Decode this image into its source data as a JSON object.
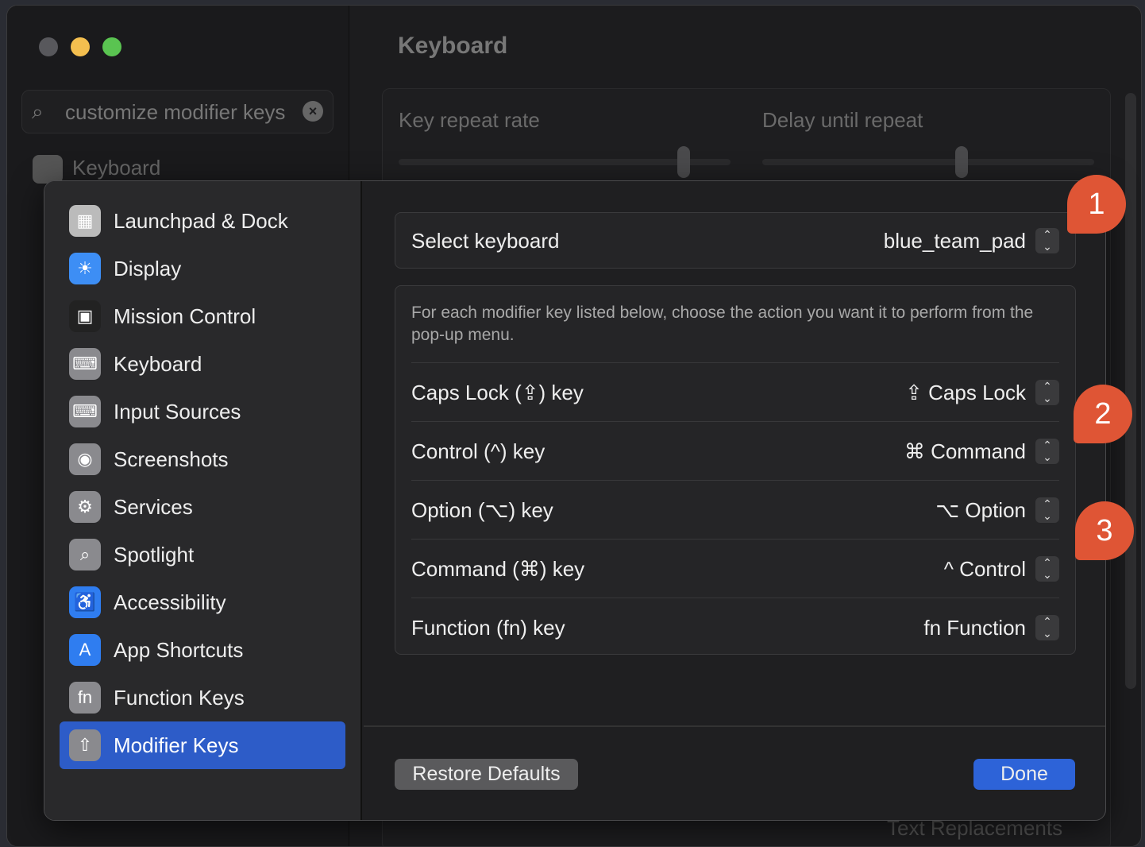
{
  "window": {
    "title": "Keyboard",
    "search": {
      "value": "customize modifier keys"
    },
    "bg_sidebar_item": "Keyboard",
    "key_repeat_label": "Key repeat rate",
    "delay_label": "Delay until repeat",
    "key_repeat_level": 0.86,
    "delay_level": 0.6,
    "bg_bottom_text": "Text Replacements"
  },
  "sheet": {
    "sidebar": [
      {
        "label": "Launchpad & Dock",
        "icon": "launchpad-icon"
      },
      {
        "label": "Display",
        "icon": "display-icon"
      },
      {
        "label": "Mission Control",
        "icon": "mission-control-icon"
      },
      {
        "label": "Keyboard",
        "icon": "keyboard-icon"
      },
      {
        "label": "Input Sources",
        "icon": "input-sources-icon"
      },
      {
        "label": "Screenshots",
        "icon": "screenshots-icon"
      },
      {
        "label": "Services",
        "icon": "services-icon"
      },
      {
        "label": "Spotlight",
        "icon": "spotlight-icon"
      },
      {
        "label": "Accessibility",
        "icon": "accessibility-icon"
      },
      {
        "label": "App Shortcuts",
        "icon": "app-shortcuts-icon"
      },
      {
        "label": "Function Keys",
        "icon": "function-keys-icon"
      },
      {
        "label": "Modifier Keys",
        "icon": "modifier-keys-icon",
        "selected": true
      }
    ],
    "select_keyboard": {
      "label": "Select keyboard",
      "value": "blue_team_pad"
    },
    "description": "For each modifier key listed below, choose the action you want it to perform from the pop-up menu.",
    "rows": [
      {
        "label": "Caps Lock (⇪) key",
        "value": "⇪ Caps Lock"
      },
      {
        "label": "Control (^) key",
        "value": "⌘ Command"
      },
      {
        "label": "Option (⌥) key",
        "value": "⌥ Option"
      },
      {
        "label": "Command (⌘) key",
        "value": "^ Control"
      },
      {
        "label": "Function (fn) key",
        "value": "fn Function"
      }
    ],
    "restore_label": "Restore Defaults",
    "done_label": "Done"
  },
  "annotations": [
    "1",
    "2",
    "3"
  ],
  "colors": {
    "accent": "#2d5cc8",
    "badge": "#df5535"
  }
}
